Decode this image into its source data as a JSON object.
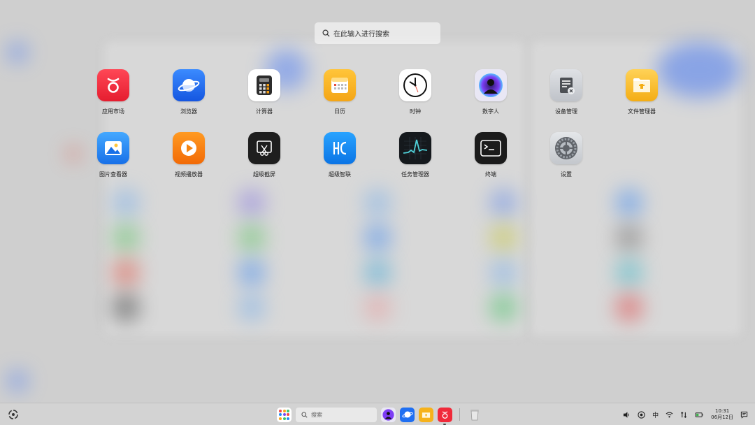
{
  "search": {
    "placeholder": "在此输入进行搜索"
  },
  "apps": [
    {
      "label": "应用市场",
      "icon": "app-store-icon",
      "color": "#f02a3a"
    },
    {
      "label": "浏览器",
      "icon": "browser-planet-icon",
      "color": "#1f6ff2"
    },
    {
      "label": "计算器",
      "icon": "calculator-icon",
      "color": "#2b2b2b"
    },
    {
      "label": "日历",
      "icon": "calendar-icon",
      "color": "#f6b21b"
    },
    {
      "label": "时钟",
      "icon": "clock-icon",
      "color": "#ffffff"
    },
    {
      "label": "数字人",
      "icon": "digital-human-icon",
      "color": "#7a4cf0"
    },
    {
      "label": "设备管理",
      "icon": "device-manager-icon",
      "color": "#5d5f64"
    },
    {
      "label": "文件管理器",
      "icon": "folder-icon",
      "color": "#f7b928"
    },
    {
      "label": "图片查看器",
      "icon": "photo-icon",
      "color": "#1e8bf5"
    },
    {
      "label": "视频播放器",
      "icon": "video-play-icon",
      "color": "#f77c0b"
    },
    {
      "label": "超级截屏",
      "icon": "screenshot-scissors-icon",
      "color": "#222222"
    },
    {
      "label": "超级智联",
      "icon": "connect-hc-icon",
      "color": "#1890ff"
    },
    {
      "label": "任务管理器",
      "icon": "activity-monitor-icon",
      "color": "#1b1f23"
    },
    {
      "label": "终端",
      "icon": "terminal-icon",
      "color": "#1a1a1a"
    },
    {
      "label": "设置",
      "icon": "gear-icon",
      "color": "#6b6f75"
    }
  ],
  "taskbar": {
    "search_placeholder": "搜索",
    "ime": "中",
    "time": "10:31",
    "date": "06月12日"
  }
}
